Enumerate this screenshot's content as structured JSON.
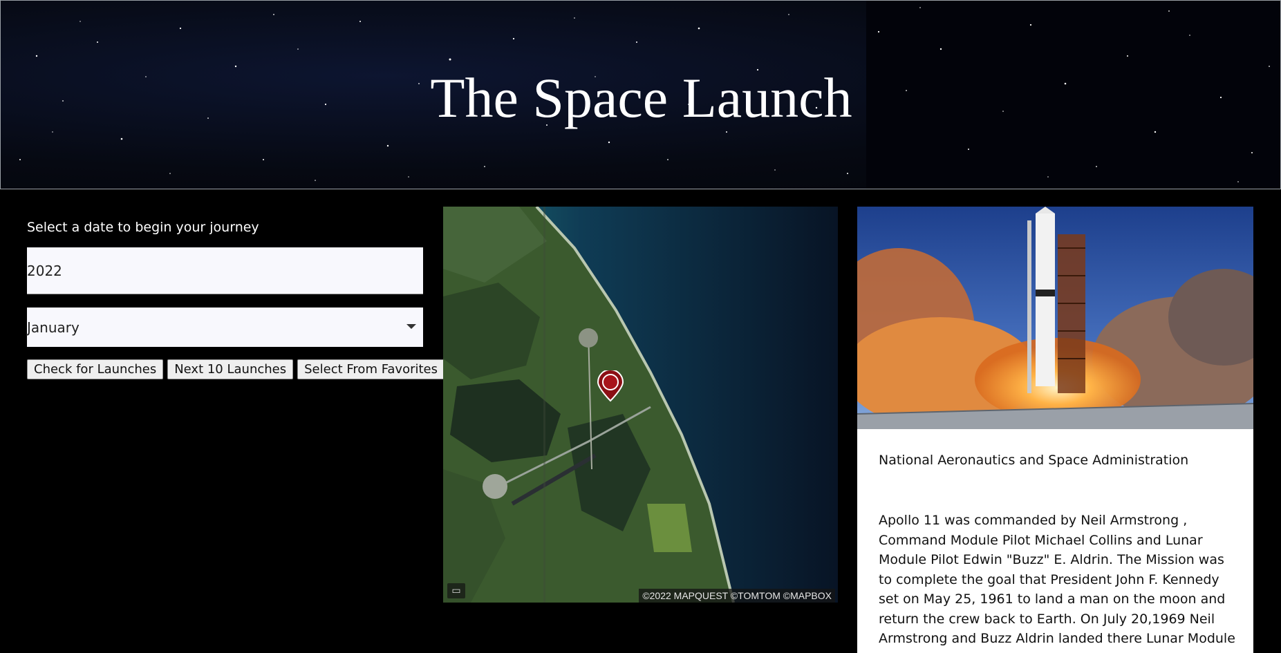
{
  "header": {
    "title": "The Space Launch"
  },
  "form": {
    "prompt": "Select a date to begin your journey",
    "year_value": "2022",
    "month_value": "January",
    "buttons": {
      "check": "Check for Launches",
      "next": "Next 10 Launches",
      "favorites": "Select From Favorites"
    }
  },
  "map": {
    "attribution": "©2022 MAPQUEST ©TOMTOM ©MAPBOX",
    "layers_icon": "layers-icon",
    "marker_icon": "map-pin-icon"
  },
  "launch_card": {
    "agency": "National Aeronautics and Space Administration",
    "description": "Apollo 11 was commanded by Neil Armstrong , Command Module Pilot Michael Collins and Lunar Module Pilot Edwin \"Buzz\" E. Aldrin. The Mission was to complete the goal that President John F. Kennedy set on May 25, 1961 to land a man on the moon and return the crew back to Earth. On July 20,1969 Neil Armstrong and Buzz Aldrin landed there Lunar Module on the sea of tranquility this marked the first time a"
  },
  "colors": {
    "background": "#000000",
    "input_bg": "#f8f8fd",
    "marker": "#8b0f14"
  }
}
